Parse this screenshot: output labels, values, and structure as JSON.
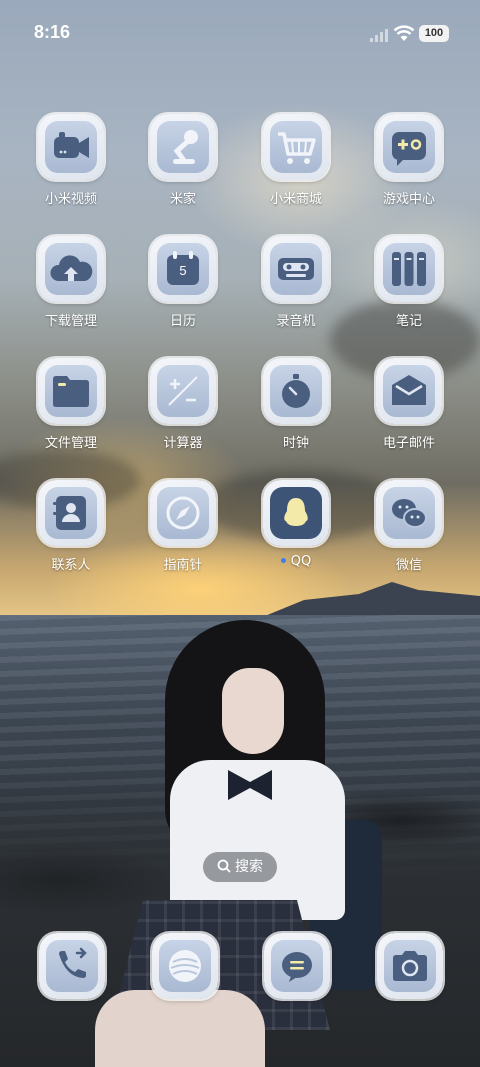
{
  "status_bar": {
    "time": "8:16",
    "battery": "100"
  },
  "apps": [
    {
      "label": "小米视频",
      "icon": "video-camera-icon"
    },
    {
      "label": "米家",
      "icon": "desk-lamp-icon"
    },
    {
      "label": "小米商城",
      "icon": "shopping-cart-icon"
    },
    {
      "label": "游戏中心",
      "icon": "gamepad-icon"
    },
    {
      "label": "下载管理",
      "icon": "cloud-upload-icon"
    },
    {
      "label": "日历",
      "icon": "calendar-icon",
      "calendar_day": "5"
    },
    {
      "label": "录音机",
      "icon": "cassette-recorder-icon"
    },
    {
      "label": "笔记",
      "icon": "notebook-icon"
    },
    {
      "label": "文件管理",
      "icon": "folder-icon"
    },
    {
      "label": "计算器",
      "icon": "calculator-icon"
    },
    {
      "label": "时钟",
      "icon": "stopwatch-icon"
    },
    {
      "label": "电子邮件",
      "icon": "envelope-icon"
    },
    {
      "label": "联系人",
      "icon": "contact-card-icon"
    },
    {
      "label": "指南针",
      "icon": "compass-icon"
    },
    {
      "label": "QQ",
      "icon": "qq-penguin-icon",
      "new_badge": true
    },
    {
      "label": "微信",
      "icon": "wechat-bubbles-icon"
    }
  ],
  "search": {
    "label": "搜索",
    "icon": "search-icon"
  },
  "dock": [
    {
      "icon": "phone-call-icon"
    },
    {
      "icon": "browser-planet-icon"
    },
    {
      "icon": "message-bubble-icon"
    },
    {
      "icon": "camera-icon"
    }
  ],
  "colors": {
    "icon_fill": "#4a5f80",
    "icon_bg": "#b9c7dd",
    "badge_dot": "#3f7df2"
  }
}
